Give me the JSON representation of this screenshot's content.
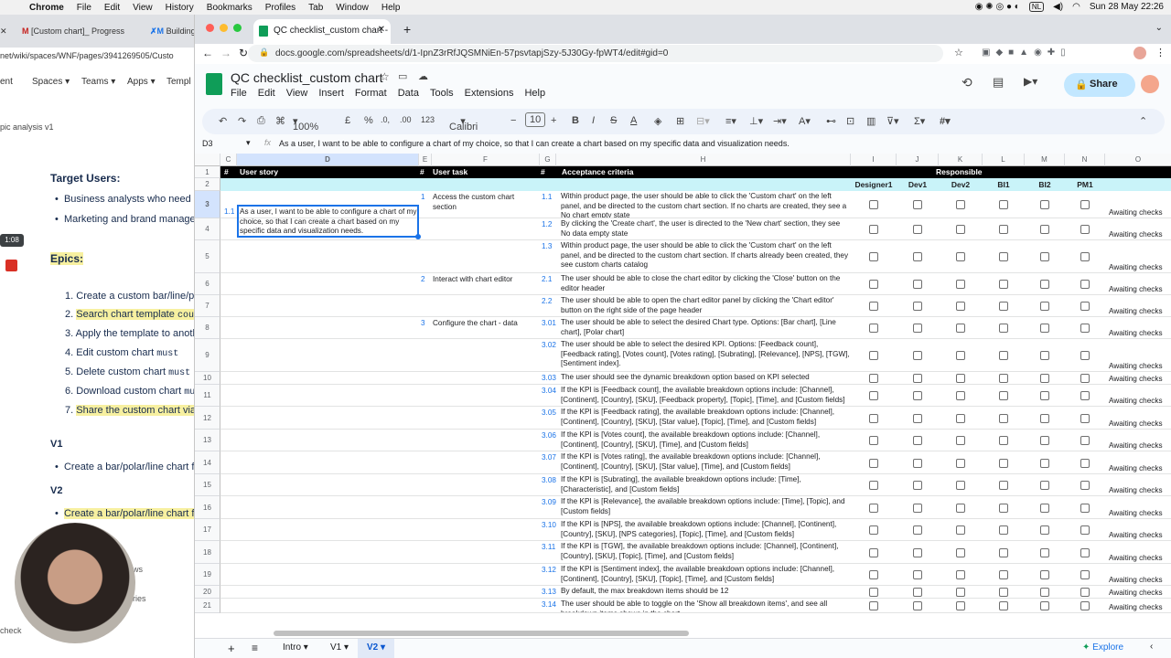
{
  "menubar": {
    "app": "Chrome",
    "items": [
      "File",
      "Edit",
      "View",
      "History",
      "Bookmarks",
      "Profiles",
      "Tab",
      "Window",
      "Help"
    ],
    "input_lang": "NL",
    "datetime": "Sun 28 May  22:26"
  },
  "bg": {
    "tab1": "[Custom chart]_ Progress",
    "tab2": "Building",
    "url": "net/wiki/spaces/WNF/pages/3941269505/Custo",
    "nav": [
      "ent",
      "Spaces",
      "Teams",
      "Apps",
      "Templ"
    ],
    "crumb": "pic analysis v1",
    "target_heading": "Target Users:",
    "users": [
      "Business analysts who need t",
      "Marketing and brand manage"
    ],
    "timer": "1:08",
    "epics_heading": "Epics:",
    "epics": [
      {
        "n": "1.",
        "text": "Create a custom bar/line/pola",
        "code": "",
        "hl": false
      },
      {
        "n": "2.",
        "text": "Search chart template",
        "code": "could",
        "hl": true
      },
      {
        "n": "3.",
        "text": "Apply the template to anothe",
        "code": "",
        "hl": false
      },
      {
        "n": "4.",
        "text": "Edit custom chart",
        "code": "must",
        "hl": false
      },
      {
        "n": "5.",
        "text": "Delete custom chart",
        "code": "must",
        "hl": false
      },
      {
        "n": "6.",
        "text": "Download custom chart",
        "code": "mus",
        "hl": false
      },
      {
        "n": "7.",
        "text": "Share the custom chart via e",
        "code": "",
        "hl": true
      }
    ],
    "v1": "V1",
    "v1_item": "Create a bar/polar/line chart f",
    "v2": "V2",
    "v2_item": "Create a bar/polar/line chart f",
    "side1": "ws",
    "side2": "ries",
    "bottom": "check"
  },
  "browser": {
    "tab_title": "QC checklist_custom chart - G",
    "url": "docs.google.com/spreadsheets/d/1-IpnZ3rRfJQSMNiEn-57psvtapjSzy-5J30Gy-fpWT4/edit#gid=0"
  },
  "sheet": {
    "title": "QC checklist_custom chart",
    "menus": [
      "File",
      "Edit",
      "View",
      "Insert",
      "Format",
      "Data",
      "Tools",
      "Extensions",
      "Help"
    ],
    "share": "Share",
    "toolbar": {
      "zoom": "100%",
      "currency": "£",
      "percent": "%",
      "dec1": ".0,",
      "dec2": ".00",
      "fmt123": "123",
      "font": "Calibri",
      "size": "10"
    },
    "namebox": "D3",
    "formula": "As a user, I want to be able to configure a chart of my choice, so that I can create a chart based on my specific data and visualization needs.",
    "columns": [
      "C",
      "D",
      "E",
      "F",
      "G",
      "H",
      "I",
      "J",
      "K",
      "L",
      "M",
      "N",
      "O"
    ],
    "header": {
      "hash1": "#",
      "story": "User story",
      "hash2": "#",
      "task": "User task",
      "hash3": "#",
      "criteria": "Acceptance criteria",
      "responsible": "Responsible"
    },
    "roles": [
      "Designer1",
      "Dev1",
      "Dev2",
      "BI1",
      "BI2",
      "PM1"
    ],
    "story_num": "1.1",
    "story_text": "As a user, I want to be able to configure a chart of my choice, so that I can create a chart based on my specific data and visualization needs.",
    "tasks": [
      {
        "n": "1",
        "text": "Access the custom chart section",
        "row": 3
      },
      {
        "n": "2",
        "text": "Interact with chart editor",
        "row": 6
      },
      {
        "n": "3",
        "text": "Configure the chart - data",
        "row": 8
      }
    ],
    "rows": [
      {
        "r": "3",
        "h": 30,
        "n": "1.1",
        "t": "Within product page, the user should be able to click the 'Custom chart' on the left panel, and be directed to the custom chart section. If no charts are created, they see a No chart empty state",
        "status": "Awaiting checks"
      },
      {
        "r": "4",
        "h": 24,
        "n": "1.2",
        "t": "By clicking the 'Create chart', the user is directed to the 'New chart' section, they see No data empty state",
        "status": "Awaiting checks"
      },
      {
        "r": "5",
        "h": 36,
        "n": "1.3",
        "t": "Within product page, the user should be able to click the 'Custom chart' on the left panel, and be directed to the custom chart section. If charts already been created, they see custom charts catalog",
        "status": "Awaiting checks"
      },
      {
        "r": "6",
        "h": 24,
        "n": "2.1",
        "t": "The user should be able to close the chart editor by clicking the 'Close' button on the editor header",
        "status": "Awaiting checks"
      },
      {
        "r": "7",
        "h": 24,
        "n": "2.2",
        "t": "The user should be able to open the chart editor panel by clicking the 'Chart editor' button on the right side of the page header",
        "status": "Awaiting checks"
      },
      {
        "r": "8",
        "h": 24,
        "n": "3.01",
        "t": "The user should be able to select the desired Chart type. Options: [Bar chart], [Line chart], [Polar chart]",
        "status": "Awaiting checks"
      },
      {
        "r": "9",
        "h": 36,
        "n": "3.02",
        "t": "The user should be able to select the desired KPI. Options: [Feedback count], [Feedback rating], [Votes count], [Votes rating], [Subrating], [Relevance], [NPS], [TGW], [Sentiment index].",
        "status": "Awaiting checks"
      },
      {
        "r": "10",
        "h": 14,
        "n": "3.03",
        "t": "The user should see the dynamic breakdown option based on KPI selected",
        "status": "Awaiting checks"
      },
      {
        "r": "11",
        "h": 24,
        "n": "3.04",
        "t": "If the KPI is [Feedback count], the available breakdown options include: [Channel], [Continent], [Country], [SKU], [Feedback property], [Topic], [Time], and [Custom fields]",
        "status": "Awaiting checks"
      },
      {
        "r": "12",
        "h": 25,
        "n": "3.05",
        "t": "If the KPI is [Feedback rating], the available breakdown options include: [Channel], [Continent], [Country], [SKU], [Star value], [Topic], [Time], and [Custom fields]",
        "status": "Awaiting checks"
      },
      {
        "r": "13",
        "h": 24,
        "n": "3.06",
        "t": "If the KPI is [Votes count], the available breakdown options include: [Channel], [Continent], [Country], [SKU], [Time],  and [Custom fields]",
        "status": "Awaiting checks"
      },
      {
        "r": "14",
        "h": 25,
        "n": "3.07",
        "t": "If the KPI is [Votes rating], the available breakdown options include: [Channel], [Continent], [Country], [SKU], [Star value], [Time], and [Custom fields]",
        "status": "Awaiting checks"
      },
      {
        "r": "15",
        "h": 24,
        "n": "3.08",
        "t": "If the KPI is [Subrating], the available breakdown options include: [Time], [Characteristic], and [Custom fields]",
        "status": "Awaiting checks"
      },
      {
        "r": "16",
        "h": 25,
        "n": "3.09",
        "t": "If the KPI is [Relevance], the available breakdown options include: [Time],  [Topic], and [Custom fields]",
        "status": "Awaiting checks"
      },
      {
        "r": "17",
        "h": 24,
        "n": "3.10",
        "t": "If the KPI is [NPS], the available breakdown options include: [Channel], [Continent], [Country], [SKU], [NPS categories], [Topic], [Time], and [Custom fields]",
        "status": "Awaiting checks"
      },
      {
        "r": "18",
        "h": 25,
        "n": "3.11",
        "t": "If the KPI is [TGW], the available breakdown options include: [Channel], [Continent], [Country], [SKU], [Topic], [Time], and [Custom fields]",
        "status": "Awaiting checks"
      },
      {
        "r": "19",
        "h": 24,
        "n": "3.12",
        "t": "If the KPI is [Sentiment index], the available breakdown options include: [Channel], [Continent], [Country], [SKU], [Topic], [Time], and [Custom fields]",
        "status": "Awaiting checks"
      },
      {
        "r": "20",
        "h": 14,
        "n": "3.13",
        "t": "By default, the max breakdown items should be 12",
        "status": "Awaiting checks"
      },
      {
        "r": "21",
        "h": 16,
        "n": "3.14",
        "t": "The user should be able to toggle on the 'Show all breakdown items', and see all breakdown items shows in the chart",
        "status": "Awaiting checks"
      }
    ],
    "sheets": [
      "Intro",
      "V1",
      "V2"
    ],
    "active_sheet": "V2",
    "explore": "Explore"
  },
  "colors": {
    "accent": "#1a73e8",
    "share": "#c2e7ff",
    "header_black": "#000000",
    "header_cyan": "#c9f3f9",
    "sheets_green": "#0f9d58"
  }
}
